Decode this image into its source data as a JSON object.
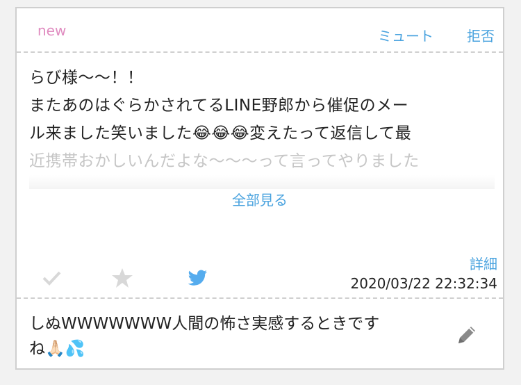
{
  "header": {
    "new_label": "new",
    "mute_label": "ミュート",
    "reject_label": "拒否"
  },
  "message": {
    "lines": [
      "らび様〜〜！！",
      "またあのはぐらかされてるLINE野郎から催促のメー",
      "ル来ました笑いました😂😂😂変えたって返信して最",
      "近携帯おかしいんだよな〜〜〜って言ってやりました"
    ],
    "show_all_label": "全部見る"
  },
  "meta": {
    "details_label": "詳細",
    "timestamp": "2020/03/22 22:32:34"
  },
  "actions": {
    "check_icon": "check-icon",
    "star_icon": "star-icon",
    "twitter_icon": "twitter-icon"
  },
  "reply": {
    "lines": [
      "しぬWWWWWWW人間の怖さ実感するときです",
      "ね🙏🏻💦"
    ],
    "edit_icon": "pencil-icon"
  },
  "colors": {
    "accent": "#4aa3df",
    "new_badge": "#e08cc0",
    "muted_icon": "#d8d8d8",
    "twitter": "#55acee"
  }
}
